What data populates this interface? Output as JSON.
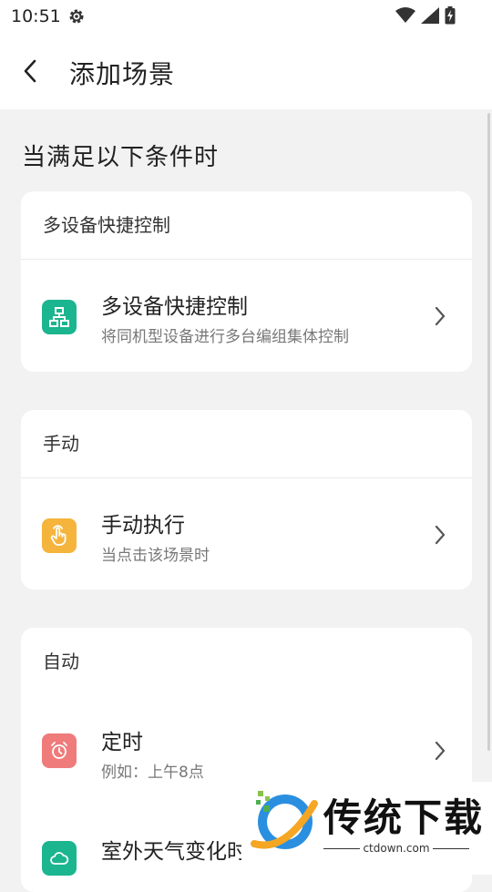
{
  "status_bar": {
    "time": "10:51",
    "icons": [
      "settings-gear-icon",
      "wifi-icon",
      "signal-icon",
      "battery-charging-icon"
    ]
  },
  "app_bar": {
    "back_icon": "chevron-left-icon",
    "title": "添加场景"
  },
  "section": {
    "title": "当满足以下条件时"
  },
  "cards": [
    {
      "header": "多设备快捷控制",
      "rows": [
        {
          "icon": "device-network-icon",
          "icon_color": "#1bb58f",
          "title": "多设备快捷控制",
          "subtitle": "将同机型设备进行多台编组集体控制"
        }
      ]
    },
    {
      "header": "手动",
      "rows": [
        {
          "icon": "tap-hand-icon",
          "icon_color": "#f5b43c",
          "title": "手动执行",
          "subtitle": "当点击该场景时"
        }
      ]
    },
    {
      "header": "自动",
      "rows": [
        {
          "icon": "alarm-clock-icon",
          "icon_color": "#f07b7b",
          "title": "定时",
          "subtitle": "例如：上午8点"
        },
        {
          "icon": "cloud-weather-icon",
          "icon_color": "#1bb58f",
          "title": "室外天气变化时",
          "subtitle": ""
        }
      ]
    }
  ],
  "watermark": {
    "text": "传统下载",
    "url": "ctdown.com"
  },
  "colors": {
    "background": "#f2f2f2",
    "card": "#ffffff",
    "text_primary": "#222222",
    "text_secondary": "#777777"
  }
}
